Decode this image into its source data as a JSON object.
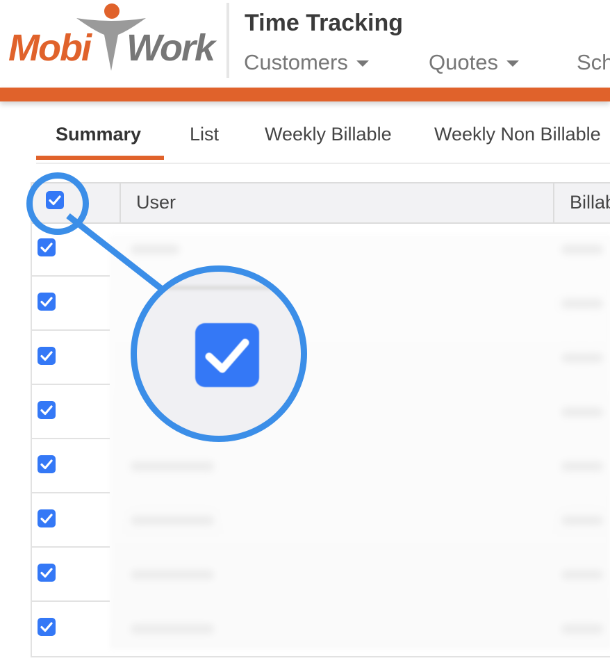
{
  "brand": {
    "logo_left": "Mobi",
    "logo_right": "Work",
    "accent": "#e0622b",
    "gray": "#777777"
  },
  "header": {
    "title": "Time Tracking",
    "nav": [
      {
        "label": "Customers",
        "has_dropdown": true
      },
      {
        "label": "Quotes",
        "has_dropdown": true
      },
      {
        "label": "Sch",
        "has_dropdown": false
      }
    ]
  },
  "tabs": [
    {
      "label": "Summary",
      "active": true
    },
    {
      "label": "List",
      "active": false
    },
    {
      "label": "Weekly Billable",
      "active": false
    },
    {
      "label": "Weekly Non Billable",
      "active": false
    }
  ],
  "table": {
    "columns": [
      "User",
      "Billab"
    ],
    "select_all_checked": true,
    "rows": [
      {
        "checked": true
      },
      {
        "checked": true
      },
      {
        "checked": true
      },
      {
        "checked": true
      },
      {
        "checked": true
      },
      {
        "checked": true
      },
      {
        "checked": true
      },
      {
        "checked": true
      }
    ]
  },
  "callout": {
    "color": "#3b8ee8",
    "highlight": "checkbox-icon"
  },
  "checkbox_color": "#3478f6"
}
